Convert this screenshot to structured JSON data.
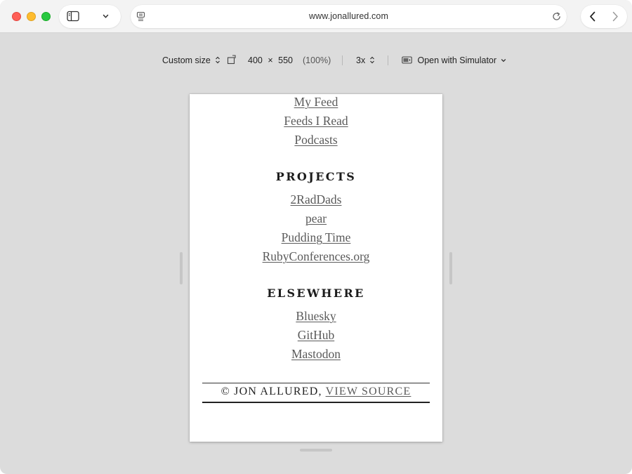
{
  "browser": {
    "url": "www.jonallured.com"
  },
  "responsive_toolbar": {
    "size_preset": "Custom size",
    "width": "400",
    "times": "×",
    "height": "550",
    "zoom": "(100%)",
    "scale": "3x",
    "open_with": "Open with Simulator"
  },
  "page": {
    "top_links": [
      "My Feed",
      "Feeds I Read",
      "Podcasts"
    ],
    "projects": {
      "title": "PROJECTS",
      "links": [
        "2RadDads",
        "pear",
        "Pudding Time",
        "RubyConferences.org"
      ]
    },
    "elsewhere": {
      "title": "ELSEWHERE",
      "links": [
        "Bluesky",
        "GitHub",
        "Mastodon"
      ]
    },
    "footer": {
      "copyright": "© JON ALLURED, ",
      "view_source": "VIEW SOURCE"
    }
  },
  "colors": {
    "close": "#ff5f57",
    "minimize": "#febc2e",
    "maximize": "#28c840",
    "link": "#5a5a5a",
    "canvas": "#dcdcdc"
  }
}
